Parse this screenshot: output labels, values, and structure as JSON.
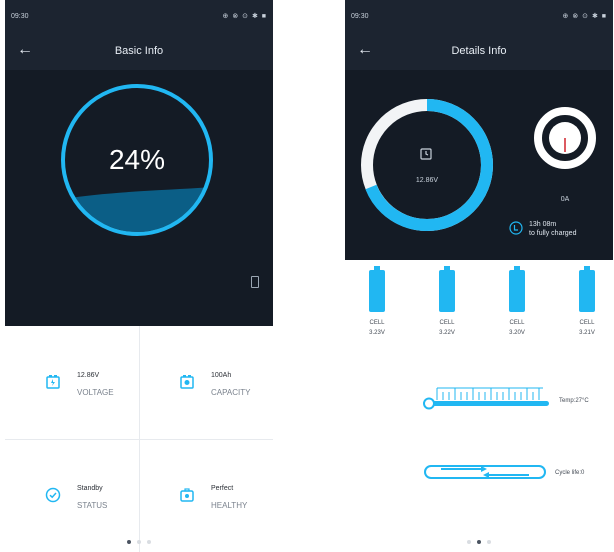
{
  "colors": {
    "dark_bg": "#141b25",
    "bar_bg": "#1c2430",
    "accent": "#21b7f2",
    "fill_water": "#0b5e86"
  },
  "left_screen": {
    "status": {
      "time": "09:30",
      "icons": "⊕ ⊗ ⊙ ✱ ■"
    },
    "title": "Basic Info",
    "gauge": {
      "percent_text": "24%",
      "level": 0.24
    },
    "info": {
      "voltage": {
        "value": "12.86V",
        "label": "VOLTAGE"
      },
      "capacity": {
        "value": "100Ah",
        "label": "CAPACITY"
      },
      "status": {
        "value": "Standby",
        "label": "STATUS"
      },
      "healthy": {
        "value": "Perfect",
        "label": "HEALTHY"
      }
    },
    "pager": {
      "count": 3,
      "active": 0
    }
  },
  "right_screen": {
    "status": {
      "time": "09:30",
      "icons": "⊕ ⊗ ⊙ ✱ ■"
    },
    "title": "Details Info",
    "donut": {
      "voltage": "12.86V",
      "fill": 0.5
    },
    "current": {
      "value": "0A"
    },
    "charge": {
      "line1": "13h 08m",
      "line2": "to fully charged"
    },
    "cells": [
      {
        "name": "CELL",
        "voltage": "3.23V"
      },
      {
        "name": "CELL",
        "voltage": "3.22V"
      },
      {
        "name": "CELL",
        "voltage": "3.20V"
      },
      {
        "name": "CELL",
        "voltage": "3.21V"
      }
    ],
    "temp": {
      "label": "Temp:27°C"
    },
    "cycle": {
      "label": "Cycle life:0"
    },
    "pager": {
      "count": 3,
      "active": 1
    }
  },
  "icons": {
    "back": "arrow-left-icon",
    "battery_small": "battery-icon",
    "voltage": "voltage-icon",
    "capacity": "capacity-icon",
    "status": "check-circle-icon",
    "healthy": "briefcase-icon",
    "alarm": "alarm-clock-icon",
    "charge": "charge-icon",
    "thermometer": "thermometer-icon",
    "cycle": "cycle-icon"
  }
}
